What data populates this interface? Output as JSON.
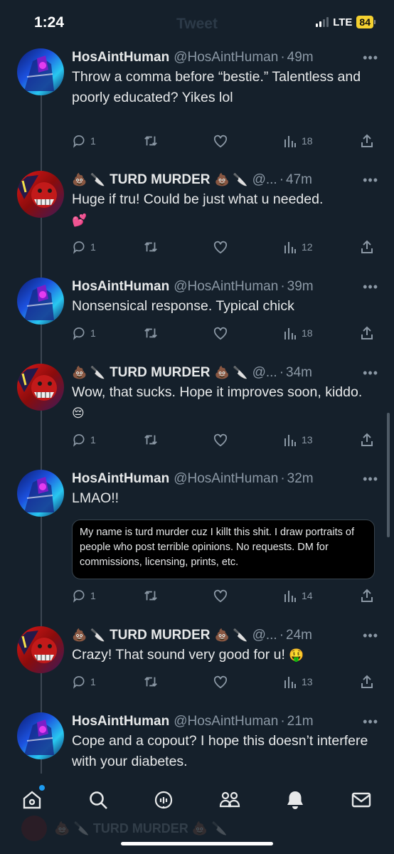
{
  "status_bar": {
    "time": "1:24",
    "network": "LTE",
    "battery": "84",
    "ghost_title": "Tweet"
  },
  "tweets": [
    {
      "name": "HosAintHuman",
      "handle": "@HosAintHuman",
      "dot": "·",
      "time": "49m",
      "text": "Throw a comma before “bestie.” Talentless and poorly educated? Yikes lol",
      "replies": "1",
      "retweets": "",
      "likes": "",
      "views": "18"
    },
    {
      "name_prefix": "💩 🔪",
      "name": "TURD MURDER",
      "name_suffix": "💩 🔪",
      "handle": "@...",
      "dot": "·",
      "time": "47m",
      "text": "Huge if tru! Could be just what u needed.",
      "emoji": "💕",
      "replies": "1",
      "retweets": "",
      "likes": "",
      "views": "12"
    },
    {
      "name": "HosAintHuman",
      "handle": "@HosAintHuman",
      "dot": "·",
      "time": "39m",
      "text": "Nonsensical response. Typical chick",
      "replies": "1",
      "retweets": "",
      "likes": "",
      "views": "18"
    },
    {
      "name_prefix": "💩 🔪",
      "name": "TURD MURDER",
      "name_suffix": "💩 🔪",
      "handle": "@...",
      "dot": "·",
      "time": "34m",
      "text": "Wow, that sucks. Hope it improves soon, kiddo.",
      "emoji": "😔",
      "replies": "1",
      "retweets": "",
      "likes": "",
      "views": "13"
    },
    {
      "name": "HosAintHuman",
      "handle": "@HosAintHuman",
      "dot": "·",
      "time": "32m",
      "text": "LMAO!!",
      "quote": "My name is turd murder cuz I killt this shit. I draw portraits of people who post terrible opinions. No requests. DM for commissions, licensing, prints, etc.",
      "replies": "1",
      "retweets": "",
      "likes": "",
      "views": "14"
    },
    {
      "name_prefix": "💩 🔪",
      "name": "TURD MURDER",
      "name_suffix": "💩 🔪",
      "handle": "@...",
      "dot": "·",
      "time": "24m",
      "text": "Crazy! That sound very good for u!",
      "emoji": "🤑",
      "replies": "1",
      "retweets": "",
      "likes": "",
      "views": "13"
    },
    {
      "name": "HosAintHuman",
      "handle": "@HosAintHuman",
      "dot": "·",
      "time": "21m",
      "text": "Cope and a copout? I hope this doesn’t interfere with your diabetes."
    }
  ],
  "tab_bar": {
    "items": [
      "home-icon",
      "search-icon",
      "spaces-icon",
      "communities-icon",
      "notifications-icon",
      "messages-icon"
    ],
    "ghost_text": "💩 🔪 TURD MURDER 💩 🔪"
  },
  "colors": {
    "background": "#15202b",
    "accent": "#1d9bf0",
    "muted": "#8b98a5",
    "text": "#e7e9ea"
  }
}
